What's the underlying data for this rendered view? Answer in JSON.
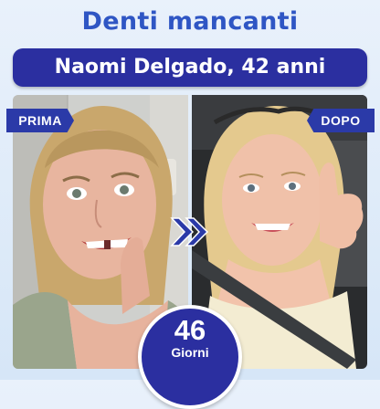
{
  "header": {
    "title": "Denti mancanti",
    "subtitle": "Naomi Delgado, 42  anni"
  },
  "labels": {
    "before": "PRIMA",
    "after": "DOPO"
  },
  "badge": {
    "number": "46",
    "unit": "Giorni"
  },
  "colors": {
    "title": "#2f56c4",
    "banner": "#2b2fa0",
    "accent": "#2b3aa8",
    "background": "#e0ecf8"
  },
  "icons": {
    "transition": "double-chevron-right-icon"
  }
}
